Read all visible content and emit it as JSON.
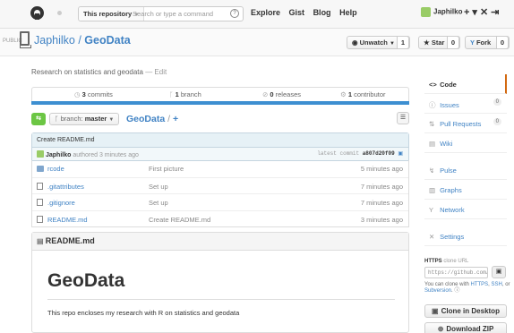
{
  "topbar": {
    "scope_label": "This repository",
    "search_placeholder": "Search or type a command",
    "search_help": "?",
    "nav": [
      "Explore",
      "Gist",
      "Blog",
      "Help"
    ],
    "username": "Japhilko",
    "icons": [
      "plus-icon",
      "tools-icon",
      "signout-icon"
    ]
  },
  "repo": {
    "visibility": "PUBLIC",
    "owner": "Japhilko",
    "separator": " / ",
    "name": "GeoData",
    "watch_label": "Unwatch",
    "watch_count": "1",
    "star_label": "Star",
    "star_count": "0",
    "fork_label": "Fork",
    "fork_count": "0"
  },
  "description": {
    "text": "Research on statistics and geodata",
    "dash": " — ",
    "edit_label": "Edit"
  },
  "stats": {
    "commits_count": "3",
    "commits_label": "commits",
    "branch_count": "1",
    "branch_label": "branch",
    "releases_count": "0",
    "releases_label": "releases",
    "contributor_count": "1",
    "contributor_label": "contributor"
  },
  "branch_bar": {
    "branch_prefix": "branch:",
    "branch_name": "master",
    "repo_link": "GeoData",
    "add_link": "+"
  },
  "commit": {
    "message": "Create README.md",
    "author": "Japhilko",
    "authored_text": "authored 3 minutes ago",
    "latest_label": "latest commit",
    "sha": "a807d20f09"
  },
  "files": [
    {
      "name": "rcode",
      "type": "dir",
      "message": "First picture",
      "age": "5 minutes ago"
    },
    {
      "name": ".gitattributes",
      "type": "file",
      "message": "Set up",
      "age": "7 minutes ago"
    },
    {
      "name": ".gitignore",
      "type": "file",
      "message": "Set up",
      "age": "7 minutes ago"
    },
    {
      "name": "README.md",
      "type": "file",
      "message": "Create README.md",
      "age": "3 minutes ago"
    }
  ],
  "readme": {
    "header": "README.md",
    "heading": "GeoData",
    "paragraph": "This repo encloses my research with R on statistics and geodata"
  },
  "sidebar": {
    "items": [
      {
        "label": "Code",
        "icon": "code-icon",
        "glyph": "<>",
        "active": true
      },
      {
        "label": "Issues",
        "icon": "issue-icon",
        "glyph": "ⓘ",
        "badge": "0"
      },
      {
        "label": "Pull Requests",
        "icon": "pull-request-icon",
        "glyph": "⇅",
        "badge": "0"
      },
      {
        "label": "Wiki",
        "icon": "wiki-icon",
        "glyph": "▤"
      },
      {
        "label": "Pulse",
        "icon": "pulse-icon",
        "glyph": "↯"
      },
      {
        "label": "Graphs",
        "icon": "graph-icon",
        "glyph": "▥"
      },
      {
        "label": "Network",
        "icon": "network-icon",
        "glyph": "Y"
      },
      {
        "label": "Settings",
        "icon": "settings-icon",
        "glyph": "✕"
      }
    ],
    "clone_title": "HTTPS",
    "clone_subtitle": "clone URL",
    "clone_url": "https://github.com/Japhilko/GeoData.git",
    "clone_note_prefix": "You can clone with",
    "clone_note_https": "HTTPS",
    "clone_note_ssh": "SSH",
    "clone_note_or": "or",
    "clone_note_sub": "Subversion",
    "desktop_label": "Clone in Desktop",
    "zip_label": "Download ZIP"
  },
  "colors": {
    "link": "#4183c4",
    "language_bar": "#3d8fd1",
    "sync_button": "#6cc644",
    "active_tab": "#d26911"
  }
}
